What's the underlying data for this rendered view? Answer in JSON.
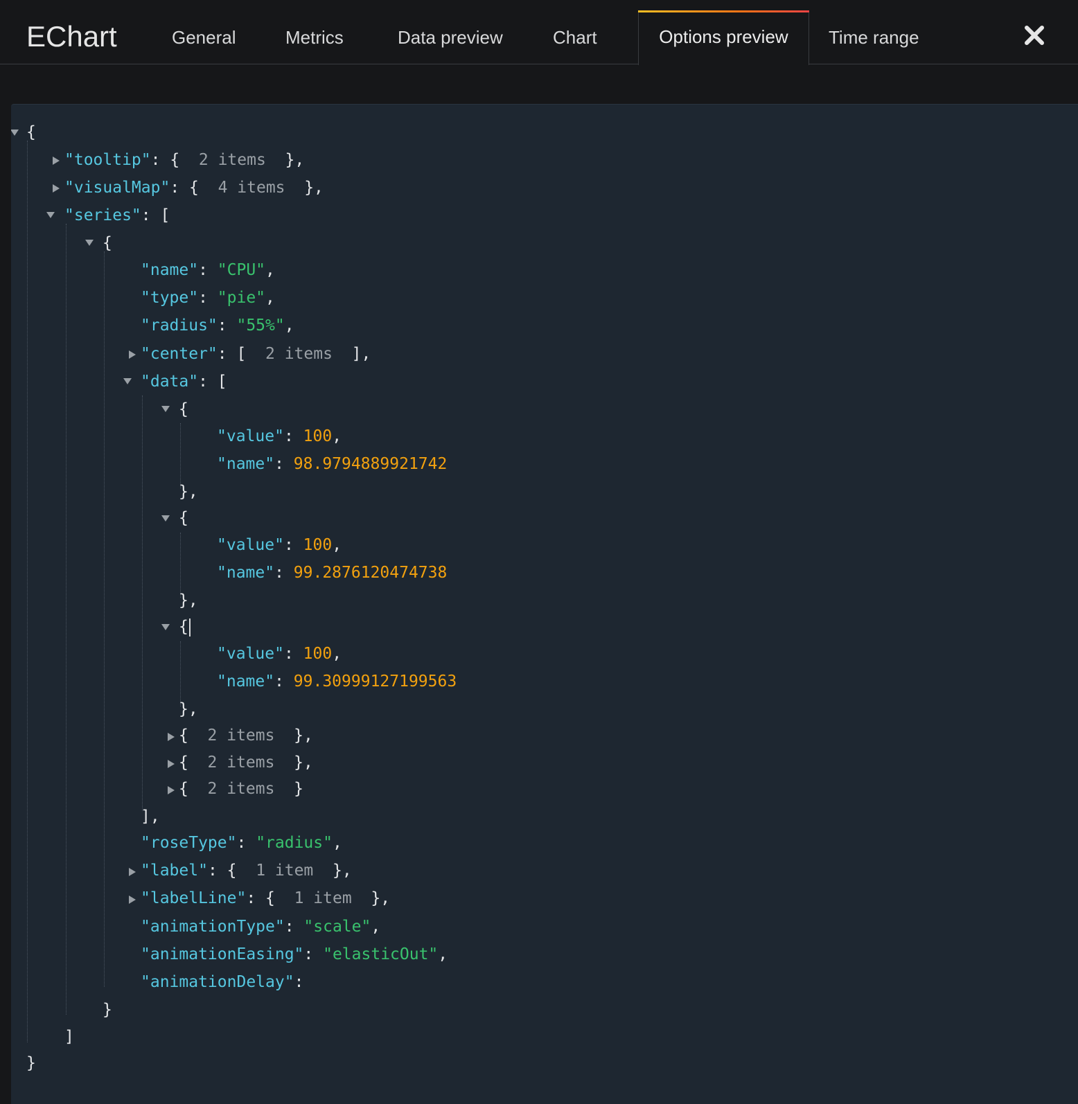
{
  "app": {
    "title": "EChart"
  },
  "tabs": [
    {
      "label": "General"
    },
    {
      "label": "Metrics"
    },
    {
      "label": "Data preview"
    },
    {
      "label": "Chart"
    },
    {
      "label": "Options preview",
      "active": true
    },
    {
      "label": "Time range"
    }
  ],
  "colors": {
    "key": "#56c7e0",
    "string": "#39c26d",
    "number": "#f2a10f",
    "punct": "#e4e6e8",
    "collapsed_count": "#9aa0a6",
    "editor_bg": "#1e2731",
    "page_bg": "#161719",
    "active_tab_accent": "#f97316"
  },
  "icons": {
    "close": "close-icon",
    "expanded": "caret-down-icon",
    "collapsed": "caret-right-icon"
  },
  "json_tree": {
    "keys": {
      "tooltip": "\"tooltip\"",
      "visualMap": "\"visualMap\"",
      "series": "\"series\"",
      "name": "\"name\"",
      "type": "\"type\"",
      "radius": "\"radius\"",
      "center": "\"center\"",
      "data": "\"data\"",
      "value": "\"value\"",
      "roseType": "\"roseType\"",
      "label": "\"label\"",
      "labelLine": "\"labelLine\"",
      "animationType": "\"animationType\"",
      "animationEasing": "\"animationEasing\"",
      "animationDelay": "\"animationDelay\""
    },
    "counts": {
      "tooltip": "2 items",
      "visualMap": "4 items",
      "center": "2 items",
      "data_item_4": "2 items",
      "data_item_5": "2 items",
      "data_item_6": "2 items",
      "label": "1 item",
      "labelLine": "1 item"
    },
    "values": {
      "name": "\"CPU\"",
      "type": "\"pie\"",
      "radius": "\"55%\"",
      "roseType": "\"radius\"",
      "animationType": "\"scale\"",
      "animationEasing": "\"elasticOut\""
    },
    "data_items": [
      {
        "value": "100",
        "name": "98.9794889921742"
      },
      {
        "value": "100",
        "name": "99.2876120474738"
      },
      {
        "value": "100",
        "name": "99.30999127199563"
      }
    ]
  }
}
